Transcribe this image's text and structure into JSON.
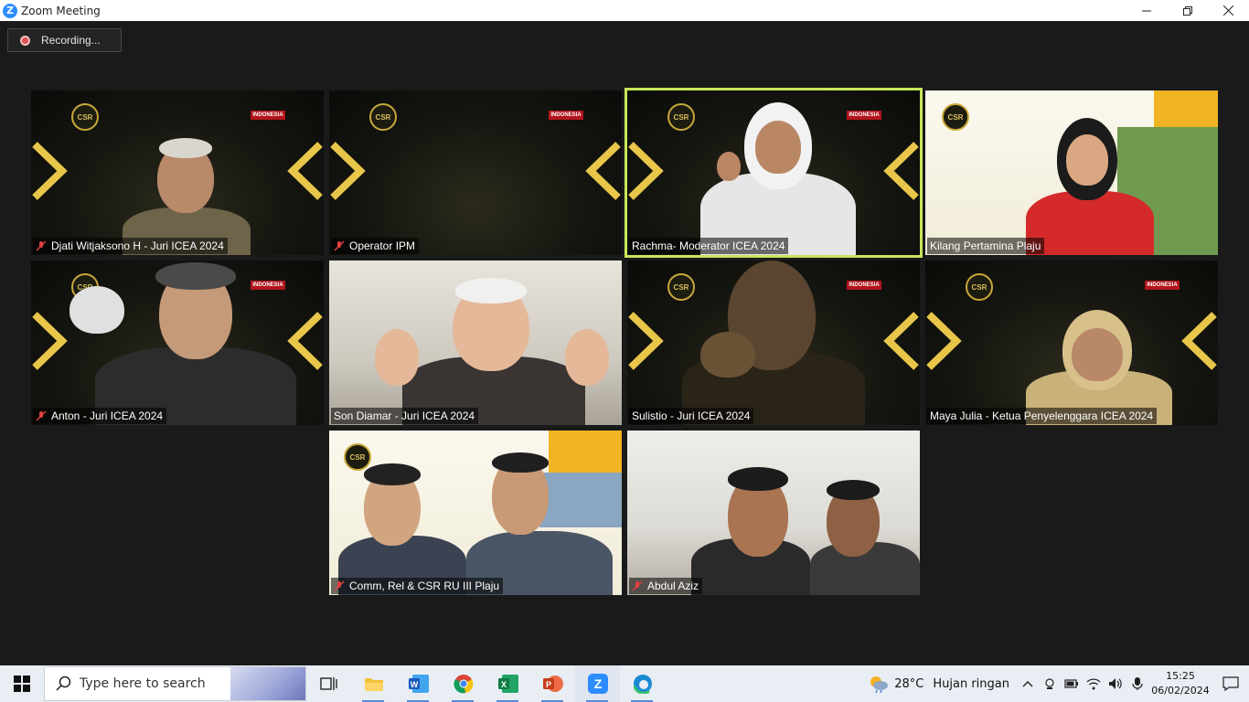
{
  "window": {
    "title": "Zoom Meeting",
    "minimize_icon": "minimize-icon",
    "restore_icon": "restore-icon",
    "close_icon": "close-icon"
  },
  "recording": {
    "label": "Recording..."
  },
  "participants": [
    {
      "name": "Djati Witjaksono H - Juri ICEA 2024",
      "muted": true,
      "background": "event-banner"
    },
    {
      "name": "Operator IPM",
      "muted": true,
      "background": "event-banner"
    },
    {
      "name": "Rachma- Moderator ICEA 2024",
      "muted": false,
      "background": "event-banner",
      "active_speaker": true
    },
    {
      "name": "Kilang Pertamina Plaju",
      "muted": false,
      "background": "pertamina-banner"
    },
    {
      "name": "Anton - Juri ICEA 2024",
      "muted": true,
      "background": "event-banner"
    },
    {
      "name": "Son Diamar - Juri ICEA 2024",
      "muted": false,
      "background": "room"
    },
    {
      "name": "Sulistio - Juri ICEA 2024",
      "muted": false,
      "background": "event-banner"
    },
    {
      "name": "Maya Julia - Ketua Penyelenggara ICEA 2024",
      "muted": false,
      "background": "event-banner"
    },
    {
      "name": "Comm, Rel & CSR RU III Plaju",
      "muted": true,
      "background": "pertamina-banner"
    },
    {
      "name": "Abdul Aziz",
      "muted": true,
      "background": "office"
    }
  ],
  "banner_text": {
    "csr_badge": "CSR",
    "sponsor": "INDONESIA"
  },
  "taskbar": {
    "search_placeholder": "Type here to search",
    "apps": [
      "task-view-icon",
      "file-explorer-icon",
      "word-icon",
      "chrome-icon",
      "excel-icon",
      "powerpoint-icon",
      "zoom-icon",
      "edge-icon"
    ],
    "weather": {
      "temp": "28°C",
      "condition": "Hujan ringan"
    },
    "clock": {
      "time": "15:25",
      "date": "06/02/2024"
    }
  },
  "colors": {
    "active_speaker_border": "#c7e65a",
    "recording_dot": "#d9534f",
    "zoom_blue": "#2d8cff",
    "meeting_bg": "#1a1a1a"
  }
}
